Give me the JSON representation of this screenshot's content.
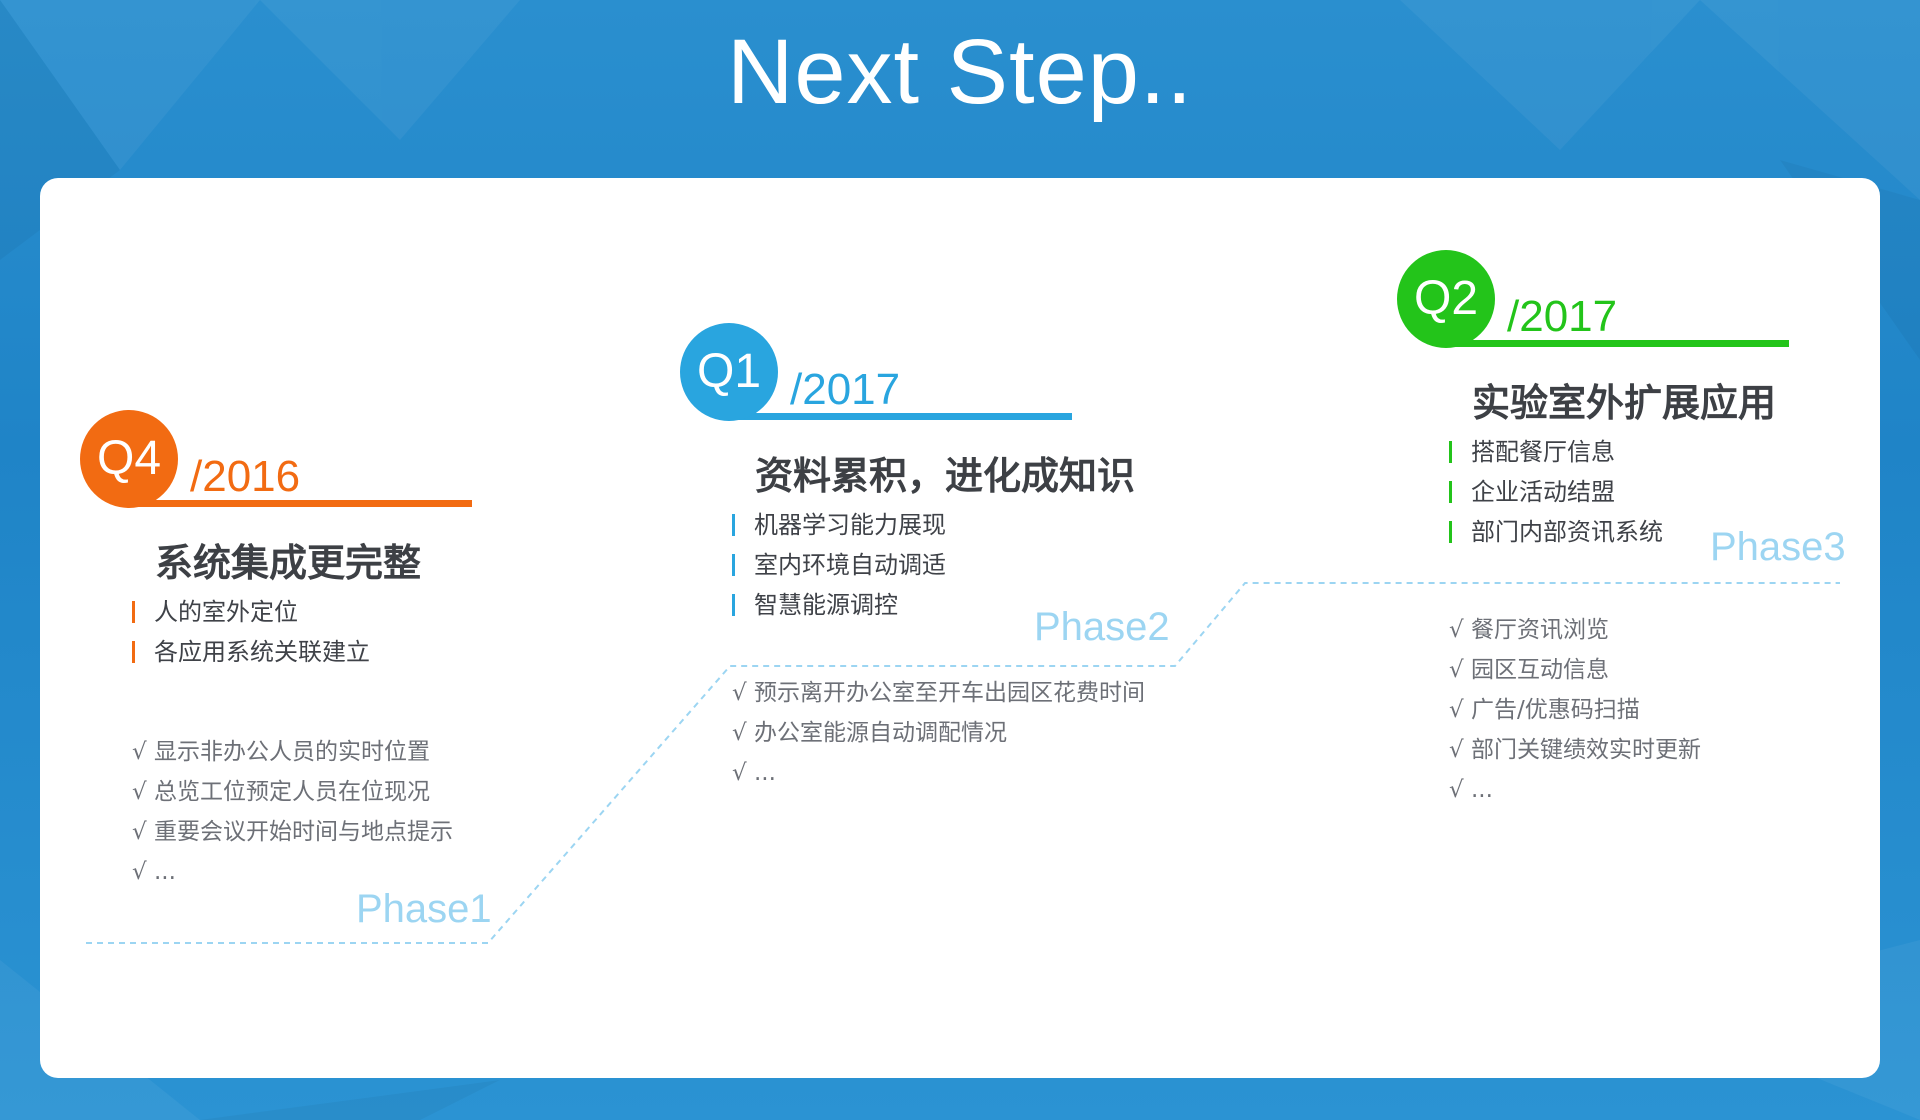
{
  "title": "Next Step..",
  "colors": {
    "orange": "#f26b12",
    "blue": "#29a5df",
    "green": "#23c41a",
    "phase_text": "#9cd5f2",
    "stair_line": "#9cd5f2"
  },
  "phases": [
    {
      "quarter": "Q4",
      "year": "/2016",
      "heading": "系统集成更完整",
      "features": [
        "人的室外定位",
        "各应用系统关联建立"
      ],
      "checks": [
        "显示非办公人员的实时位置",
        "总览工位预定人员在位现况",
        "重要会议开始时间与地点提示",
        "..."
      ],
      "label": "Phase1"
    },
    {
      "quarter": "Q1",
      "year": "/2017",
      "heading": "资料累积，进化成知识",
      "features": [
        "机器学习能力展现",
        "室内环境自动调适",
        "智慧能源调控"
      ],
      "checks": [
        "预示离开办公室至开车出园区花费时间",
        "办公室能源自动调配情况",
        "..."
      ],
      "label": "Phase2"
    },
    {
      "quarter": "Q2",
      "year": "/2017",
      "heading": "实验室外扩展应用",
      "features": [
        "搭配餐厅信息",
        "企业活动结盟",
        "部门内部资讯系统"
      ],
      "checks": [
        "餐厅资讯浏览",
        "园区互动信息",
        "广告/优惠码扫描",
        "部门关键绩效实时更新",
        "..."
      ],
      "label": "Phase3"
    }
  ],
  "check_mark": "√"
}
